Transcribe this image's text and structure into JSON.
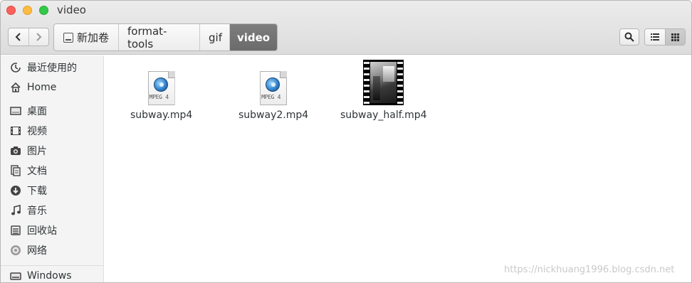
{
  "window": {
    "title": "video"
  },
  "toolbar": {
    "back_icon": "chevron-left-icon",
    "forward_icon": "chevron-right-icon",
    "breadcrumbs": [
      {
        "label": "新加卷",
        "icon": "drive-icon"
      },
      {
        "label": "format-tools"
      },
      {
        "label": "gif"
      },
      {
        "label": "video",
        "active": true
      }
    ],
    "search_icon": "search-icon",
    "view_list_icon": "list-view-icon",
    "view_grid_icon": "grid-view-icon"
  },
  "sidebar": {
    "items": [
      {
        "label": "最近使用的",
        "icon": "recent-icon"
      },
      {
        "label": "Home",
        "icon": "home-icon"
      },
      {
        "label": "桌面",
        "icon": "desktop-icon"
      },
      {
        "label": "视频",
        "icon": "video-icon"
      },
      {
        "label": "图片",
        "icon": "camera-icon"
      },
      {
        "label": "文档",
        "icon": "document-icon"
      },
      {
        "label": "下载",
        "icon": "download-icon"
      },
      {
        "label": "音乐",
        "icon": "music-icon"
      },
      {
        "label": "回收站",
        "icon": "trash-icon"
      },
      {
        "label": "网络",
        "icon": "network-icon"
      },
      {
        "label": "Windows",
        "icon": "drive-icon"
      }
    ]
  },
  "files": [
    {
      "name": "subway.mp4",
      "icon": "mpeg4-icon",
      "icon_label": "MPEG 4"
    },
    {
      "name": "subway2.mp4",
      "icon": "mpeg4-icon",
      "icon_label": "MPEG 4"
    },
    {
      "name": "subway_half.mp4",
      "icon": "video-thumbnail"
    }
  ],
  "watermark": "https://nickhuang1996.blog.csdn.net"
}
